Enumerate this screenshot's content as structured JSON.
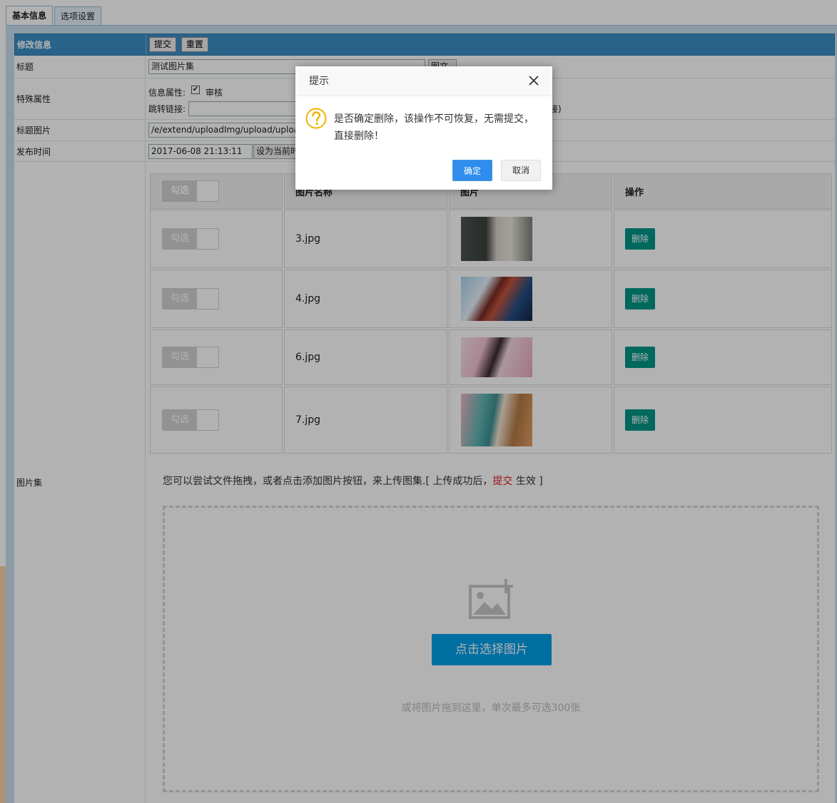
{
  "tabs": [
    {
      "label": "基本信息",
      "active": true
    },
    {
      "label": "选项设置",
      "active": false
    }
  ],
  "form": {
    "header_label": "修改信息",
    "submit_label": "提交",
    "reset_label": "重置",
    "title_label": "标题",
    "title_value": "测试图片集",
    "title_btn_partial": "图文",
    "special_label": "特殊属性",
    "info_attr_label": "信息属性:",
    "audit_label": "审核",
    "audit_checked": true,
    "jump_label": "跳转链接:",
    "jump_tail": "接)",
    "title_img_label": "标题图片",
    "title_img_value": "/e/extend/uploadImg/upload/upload_",
    "pub_time_label": "发布时间",
    "pub_time_value": "2017-06-08 21:13:11",
    "set_now_label": "设为当前时",
    "gallery_label": "图片集"
  },
  "gallery": {
    "headers": [
      "勾选",
      "图片名称",
      "图片",
      "操作"
    ],
    "toggle_label": "勾选",
    "delete_label": "删除",
    "rows": [
      {
        "name": "3.jpg"
      },
      {
        "name": "4.jpg"
      },
      {
        "name": "6.jpg"
      },
      {
        "name": "7.jpg"
      }
    ]
  },
  "upload": {
    "hint_before": "您可以尝试文件拖拽，或者点击添加图片按钮，来上传图集.[ 上传成功后，",
    "hint_red": "提交",
    "hint_after": " 生效 ]",
    "pick_label": "点击选择图片",
    "drop_tip": "或将图片拖到这里，单次最多可选300张"
  },
  "dialog": {
    "title": "提示",
    "message": "是否确定删除，该操作不可恢复，无需提交，直接删除！",
    "ok_label": "确定",
    "cancel_label": "取消"
  },
  "colors": {
    "header_blue": "#3b8fc4",
    "delete_green": "#009688",
    "pick_blue": "#00a0e9",
    "ok_blue": "#2e8ded"
  }
}
